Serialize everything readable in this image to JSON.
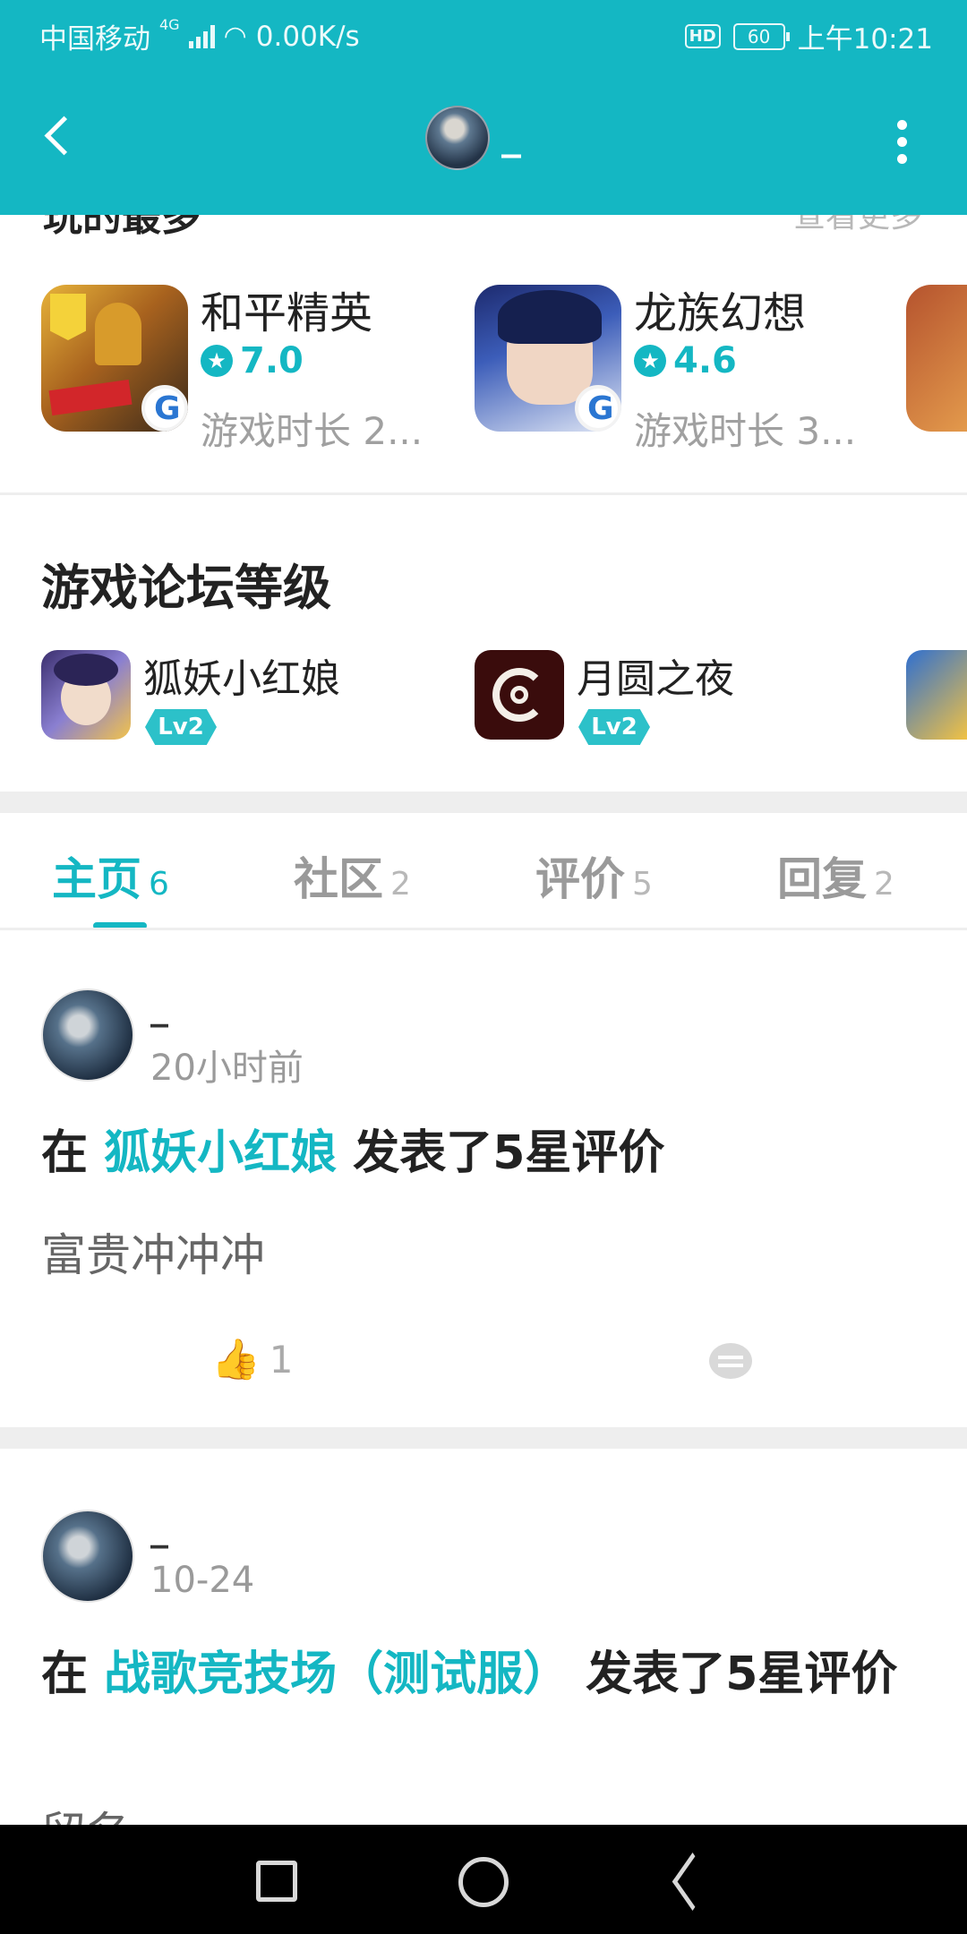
{
  "status_bar": {
    "carrier": "中国移动",
    "network": "4G",
    "speed": "0.00K/s",
    "hd": "HD",
    "battery": "60",
    "time": "上午10:21"
  },
  "header": {
    "username": "_",
    "back_icon": "chevron-left-icon",
    "menu_icon": "more-vertical-icon"
  },
  "played_section": {
    "title": "玩的最多",
    "more_label": "查看更多",
    "games": [
      {
        "name": "和平精英",
        "rating": "7.0",
        "playtime": "游戏时长 2..."
      },
      {
        "name": "龙族幻想",
        "rating": "4.6",
        "playtime": "游戏时长 3..."
      }
    ]
  },
  "forum_section": {
    "title": "游戏论坛等级",
    "forums": [
      {
        "name": "狐妖小红娘",
        "level": "Lv2"
      },
      {
        "name": "月圆之夜",
        "level": "Lv2"
      }
    ]
  },
  "tabs": [
    {
      "label": "主页",
      "count": "6"
    },
    {
      "label": "社区",
      "count": "2"
    },
    {
      "label": "评价",
      "count": "5"
    },
    {
      "label": "回复",
      "count": "2"
    }
  ],
  "posts": [
    {
      "user": "_",
      "time": "20小时前",
      "prefix": "在 ",
      "game": "狐妖小红娘",
      "suffix": " 发表了5星评价",
      "body": "富贵冲冲冲",
      "likes": "1"
    },
    {
      "user": "_",
      "time": "10-24",
      "prefix": "在 ",
      "game": "战歌竞技场（测试服）",
      "suffix": " 发表了5星评价",
      "body": "留名"
    }
  ],
  "colors": {
    "accent": "#14b7c3",
    "divider": "#eeeeee"
  }
}
